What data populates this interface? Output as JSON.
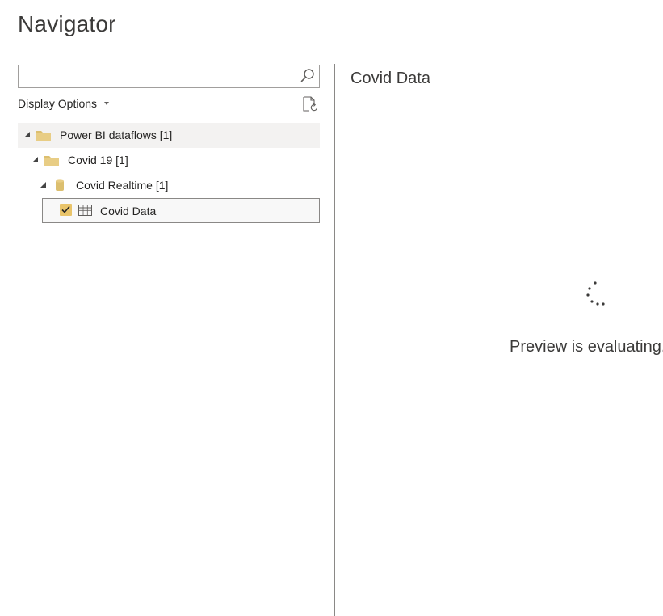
{
  "window": {
    "title": "Navigator"
  },
  "search": {
    "value": "",
    "placeholder": ""
  },
  "display_options": {
    "label": "Display Options"
  },
  "tree": {
    "items": [
      {
        "label": "Power BI dataflows [1]",
        "icon": "folder-icon",
        "level": 0,
        "expanded": true
      },
      {
        "label": "Covid 19 [1]",
        "icon": "folder-icon",
        "level": 1,
        "expanded": true
      },
      {
        "label": "Covid Realtime [1]",
        "icon": "database-icon",
        "level": 2,
        "expanded": true
      },
      {
        "label": "Covid Data",
        "icon": "table-icon",
        "level": 3,
        "checked": true
      }
    ]
  },
  "preview": {
    "title": "Covid Data",
    "status": "Preview is evaluating..."
  },
  "colors": {
    "folder": "#dcbf6f",
    "checkbox": "#e9c46a",
    "divider": "#8a8886",
    "text": "#252423"
  }
}
